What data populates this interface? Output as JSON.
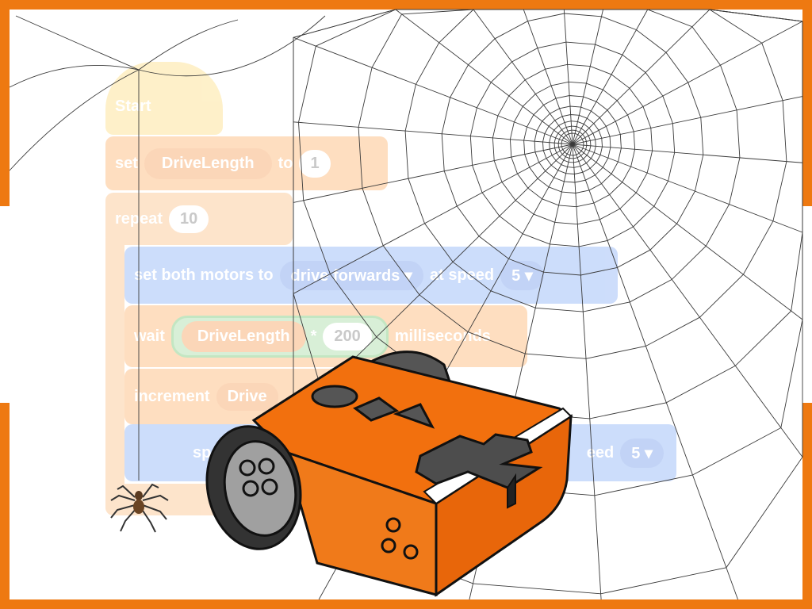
{
  "code_blocks": {
    "start_label": "Start",
    "set_label": "set",
    "set_variable": "DriveLength",
    "to_label": "to",
    "set_value": "1",
    "repeat_label": "repeat",
    "repeat_count": "10",
    "motors_label": "set both motors to",
    "motors_direction": "drive forwards",
    "speed_label": "at speed",
    "speed_value": "5",
    "wait_label": "wait",
    "wait_variable": "DriveLength",
    "multiply_sign": "*",
    "multiply_value": "200",
    "milliseconds_label": "milliseconds",
    "increment_label": "increment",
    "increment_variable": "Drive",
    "second_motors_fragment": "sp",
    "second_speed_fragment": "eed",
    "second_speed_value": "5"
  },
  "colors": {
    "frame": "#ee7911",
    "robot_body": "#f2700e",
    "robot_dark": "#4d4d4d",
    "wheel": "#333333"
  },
  "icons": [
    "spider-web",
    "spider",
    "edison-robot"
  ]
}
